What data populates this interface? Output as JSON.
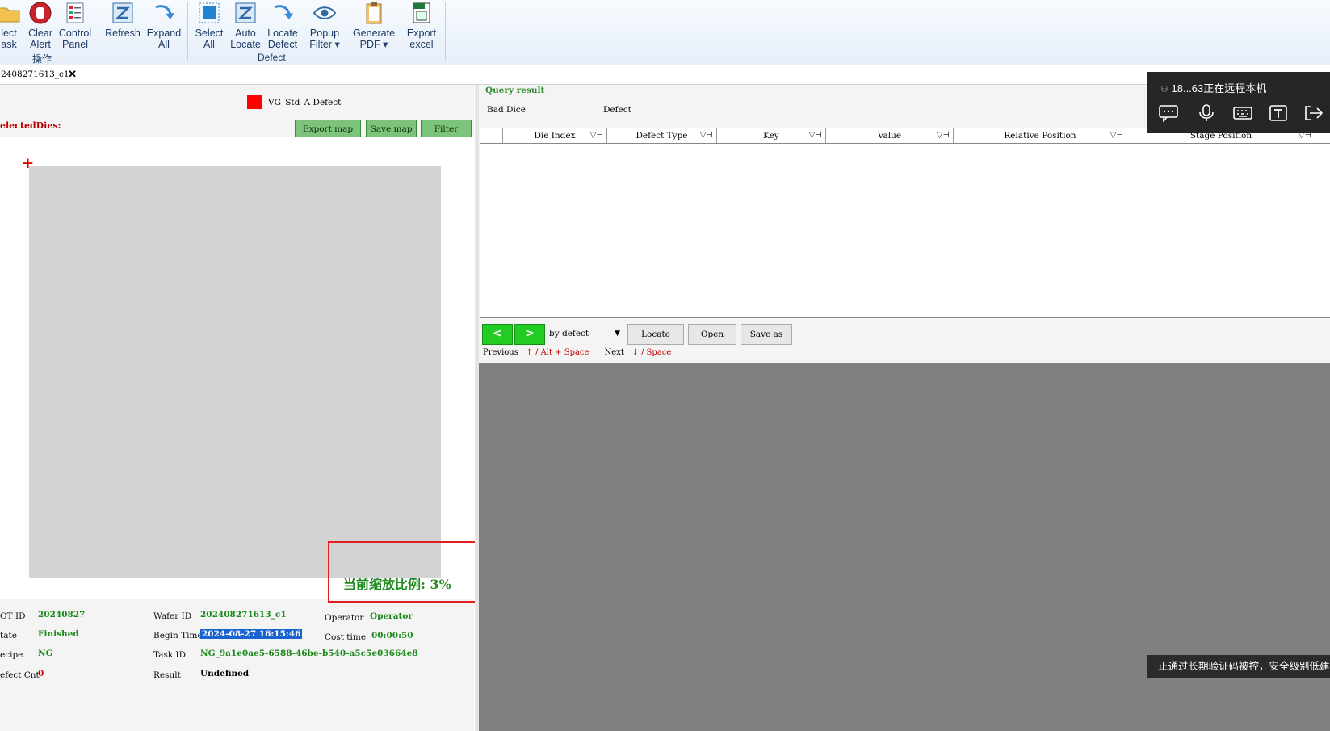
{
  "ribbon": {
    "buttons": [
      {
        "id": "select-task",
        "line1": "lect",
        "line2": "ask"
      },
      {
        "id": "clear-alert",
        "line1": "Clear",
        "line2": "Alert"
      },
      {
        "id": "control-panel",
        "line1": "Control",
        "line2": "Panel"
      },
      {
        "id": "refresh",
        "line1": "Refresh",
        "line2": ""
      },
      {
        "id": "expand-all",
        "line1": "Expand",
        "line2": "All"
      },
      {
        "id": "select-all",
        "line1": "Select",
        "line2": "All"
      },
      {
        "id": "auto-locate",
        "line1": "Auto",
        "line2": "Locate"
      },
      {
        "id": "locate-defect",
        "line1": "Locate",
        "line2": "Defect"
      },
      {
        "id": "popup-filter",
        "line1": "Popup",
        "line2": "Filter ▾"
      },
      {
        "id": "generate-pdf",
        "line1": "Generate",
        "line2": "PDF ▾"
      },
      {
        "id": "export-excel",
        "line1": "Export",
        "line2": "excel"
      }
    ],
    "group_operate": "操作",
    "group_defect": "Defect",
    "colors": {
      "accent": "#1e3c66",
      "ribbon_bg": "#e6eef8"
    }
  },
  "tab": {
    "label": "2408271613_c1",
    "close": "✕"
  },
  "map": {
    "legend_label": "VG_Std_A Defect",
    "legend_color": "#ff0000",
    "selected_dies_label": "electedDies:",
    "export_map": "Export map",
    "save_map": "Save map",
    "filter": "Filter",
    "zoom_label": "当前缩放比例: 3%"
  },
  "info": {
    "lot_id_key": "OT ID",
    "lot_id": "20240827",
    "state_key": "tate",
    "state": "Finished",
    "recipe_key": "ecipe",
    "recipe": "NG",
    "defect_cnt_key": "efect Cnt",
    "defect_cnt": "0",
    "wafer_id_key": "Wafer ID",
    "wafer_id": "202408271613_c1",
    "begin_time_key": "Begin Time",
    "begin_time": "2024-08-27 16:15:46",
    "task_id_key": "Task ID",
    "task_id": "NG_9a1e0ae5-6588-46be-b540-a5c5e03664e8",
    "result_key": "Result",
    "result": "Undefined",
    "operator_key": "Operator",
    "operator": "Operator",
    "cost_time_key": "Cost time",
    "cost_time": "00:00:50"
  },
  "query": {
    "title": "Query result",
    "bad_dice": "Bad Dice",
    "defect": "Defect",
    "columns": [
      "Die Index",
      "Defect Type",
      "Key",
      "Value",
      "Relative Position",
      "Stage Position"
    ],
    "rows": []
  },
  "nav": {
    "prev": "<",
    "next": ">",
    "mode": "by defect",
    "locate": "Locate",
    "open": "Open",
    "save_as": "Save as",
    "previous_label": "Previous",
    "prev_arrow": "↑",
    "prev_keys": "/ Alt + Space",
    "next_label": "Next",
    "next_arrow": "↓",
    "next_keys": "/ Space"
  },
  "remote": {
    "title": "18...63正在远程本机"
  },
  "toast": {
    "text": "正通过长期验证码被控，安全级别低建议"
  }
}
